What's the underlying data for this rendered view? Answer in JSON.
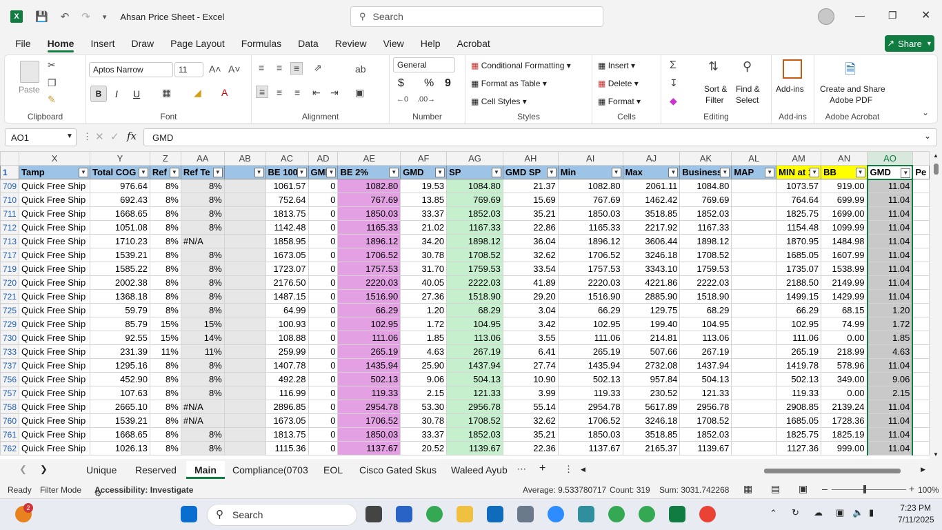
{
  "app": {
    "title": "Ahsan Price Sheet  -  Excel",
    "search_label": "Search"
  },
  "menu": [
    "File",
    "Home",
    "Insert",
    "Draw",
    "Page Layout",
    "Formulas",
    "Data",
    "Review",
    "View",
    "Help",
    "Acrobat"
  ],
  "share_label": "Share",
  "ribbon": {
    "clipboard": {
      "paste": "Paste",
      "group": "Clipboard"
    },
    "font": {
      "name": "Aptos Narrow",
      "size": "11",
      "group": "Font",
      "bold": "B",
      "italic": "I",
      "underline": "U"
    },
    "alignment": {
      "group": "Alignment"
    },
    "number": {
      "format": "General",
      "group": "Number",
      "currency": "$",
      "percent": "%",
      "comma": "9"
    },
    "styles": {
      "cond": "Conditional Formatting",
      "table": "Format as Table",
      "cell": "Cell Styles",
      "group": "Styles"
    },
    "cells": {
      "insert": "Insert",
      "delete": "Delete",
      "format": "Format",
      "group": "Cells"
    },
    "editing": {
      "sort1": "Sort &",
      "sort2": "Filter",
      "find1": "Find &",
      "find2": "Select",
      "group": "Editing"
    },
    "addins": {
      "label": "Add-ins",
      "group": "Add-ins"
    },
    "acrobat": {
      "label1": "Create and Share",
      "label2": "Adobe PDF",
      "group": "Adobe Acrobat"
    }
  },
  "formula": {
    "namebox": "AO1",
    "fx": "fx",
    "content": "GMD"
  },
  "columns": [
    "X",
    "Y",
    "Z",
    "AA",
    "AB",
    "AC",
    "AD",
    "AE",
    "AF",
    "AG",
    "AH",
    "AI",
    "AJ",
    "AK",
    "AL",
    "AM",
    "AN",
    "AO",
    ""
  ],
  "header_row": {
    "num": "1",
    "cells": [
      "Tamp",
      "Total COG",
      "Ref",
      "Ref Te",
      "",
      "BE 100",
      "GMI",
      "BE 2%",
      "GMD",
      "SP",
      "GMD SP",
      "Min",
      "Max",
      "Business",
      "MAP",
      "MIN at 1",
      "BB",
      "GMD",
      "Pe"
    ]
  },
  "rows": [
    {
      "num": "709",
      "cells": [
        "Quick Free Ship",
        "976.64",
        "8%",
        "8%",
        "",
        "1061.57",
        "0",
        "1082.80",
        "19.53",
        "1084.80",
        "21.37",
        "1082.80",
        "2061.11",
        "1084.80",
        "",
        "1073.57",
        "919.00",
        "11.04"
      ]
    },
    {
      "num": "710",
      "cells": [
        "Quick Free Ship",
        "692.43",
        "8%",
        "8%",
        "",
        "752.64",
        "0",
        "767.69",
        "13.85",
        "769.69",
        "15.69",
        "767.69",
        "1462.42",
        "769.69",
        "",
        "764.64",
        "699.99",
        "11.04"
      ]
    },
    {
      "num": "711",
      "cells": [
        "Quick Free Ship",
        "1668.65",
        "8%",
        "8%",
        "",
        "1813.75",
        "0",
        "1850.03",
        "33.37",
        "1852.03",
        "35.21",
        "1850.03",
        "3518.85",
        "1852.03",
        "",
        "1825.75",
        "1699.00",
        "11.04"
      ]
    },
    {
      "num": "712",
      "cells": [
        "Quick Free Ship",
        "1051.08",
        "8%",
        "8%",
        "",
        "1142.48",
        "0",
        "1165.33",
        "21.02",
        "1167.33",
        "22.86",
        "1165.33",
        "2217.92",
        "1167.33",
        "",
        "1154.48",
        "1099.99",
        "11.04"
      ]
    },
    {
      "num": "713",
      "cells": [
        "Quick Free Ship",
        "1710.23",
        "8%",
        "#N/A",
        "",
        "1858.95",
        "0",
        "1896.12",
        "34.20",
        "1898.12",
        "36.04",
        "1896.12",
        "3606.44",
        "1898.12",
        "",
        "1870.95",
        "1484.98",
        "11.04"
      ]
    },
    {
      "num": "717",
      "cells": [
        "Quick Free Ship",
        "1539.21",
        "8%",
        "8%",
        "",
        "1673.05",
        "0",
        "1706.52",
        "30.78",
        "1708.52",
        "32.62",
        "1706.52",
        "3246.18",
        "1708.52",
        "",
        "1685.05",
        "1607.99",
        "11.04"
      ]
    },
    {
      "num": "719",
      "cells": [
        "Quick Free Ship",
        "1585.22",
        "8%",
        "8%",
        "",
        "1723.07",
        "0",
        "1757.53",
        "31.70",
        "1759.53",
        "33.54",
        "1757.53",
        "3343.10",
        "1759.53",
        "",
        "1735.07",
        "1538.99",
        "11.04"
      ]
    },
    {
      "num": "720",
      "cells": [
        "Quick Free Ship",
        "2002.38",
        "8%",
        "8%",
        "",
        "2176.50",
        "0",
        "2220.03",
        "40.05",
        "2222.03",
        "41.89",
        "2220.03",
        "4221.86",
        "2222.03",
        "",
        "2188.50",
        "2149.99",
        "11.04"
      ]
    },
    {
      "num": "721",
      "cells": [
        "Quick Free Ship",
        "1368.18",
        "8%",
        "8%",
        "",
        "1487.15",
        "0",
        "1516.90",
        "27.36",
        "1518.90",
        "29.20",
        "1516.90",
        "2885.90",
        "1518.90",
        "",
        "1499.15",
        "1429.99",
        "11.04"
      ]
    },
    {
      "num": "725",
      "cells": [
        "Quick Free Ship",
        "59.79",
        "8%",
        "8%",
        "",
        "64.99",
        "0",
        "66.29",
        "1.20",
        "68.29",
        "3.04",
        "66.29",
        "129.75",
        "68.29",
        "",
        "66.29",
        "68.15",
        "1.20"
      ]
    },
    {
      "num": "729",
      "cells": [
        "Quick Free Ship",
        "85.79",
        "15%",
        "15%",
        "",
        "100.93",
        "0",
        "102.95",
        "1.72",
        "104.95",
        "3.42",
        "102.95",
        "199.40",
        "104.95",
        "",
        "102.95",
        "74.99",
        "1.72"
      ]
    },
    {
      "num": "730",
      "cells": [
        "Quick Free Ship",
        "92.55",
        "15%",
        "14%",
        "",
        "108.88",
        "0",
        "111.06",
        "1.85",
        "113.06",
        "3.55",
        "111.06",
        "214.81",
        "113.06",
        "",
        "111.06",
        "0.00",
        "1.85"
      ]
    },
    {
      "num": "733",
      "cells": [
        "Quick Free Ship",
        "231.39",
        "11%",
        "11%",
        "",
        "259.99",
        "0",
        "265.19",
        "4.63",
        "267.19",
        "6.41",
        "265.19",
        "507.66",
        "267.19",
        "",
        "265.19",
        "218.99",
        "4.63"
      ]
    },
    {
      "num": "737",
      "cells": [
        "Quick Free Ship",
        "1295.16",
        "8%",
        "8%",
        "",
        "1407.78",
        "0",
        "1435.94",
        "25.90",
        "1437.94",
        "27.74",
        "1435.94",
        "2732.08",
        "1437.94",
        "",
        "1419.78",
        "578.96",
        "11.04"
      ]
    },
    {
      "num": "756",
      "cells": [
        "Quick Free Ship",
        "452.90",
        "8%",
        "8%",
        "",
        "492.28",
        "0",
        "502.13",
        "9.06",
        "504.13",
        "10.90",
        "502.13",
        "957.84",
        "504.13",
        "",
        "502.13",
        "349.00",
        "9.06"
      ]
    },
    {
      "num": "757",
      "cells": [
        "Quick Free Ship",
        "107.63",
        "8%",
        "8%",
        "",
        "116.99",
        "0",
        "119.33",
        "2.15",
        "121.33",
        "3.99",
        "119.33",
        "230.52",
        "121.33",
        "",
        "119.33",
        "0.00",
        "2.15"
      ]
    },
    {
      "num": "758",
      "cells": [
        "Quick Free Ship",
        "2665.10",
        "8%",
        "#N/A",
        "",
        "2896.85",
        "0",
        "2954.78",
        "53.30",
        "2956.78",
        "55.14",
        "2954.78",
        "5617.89",
        "2956.78",
        "",
        "2908.85",
        "2139.24",
        "11.04"
      ]
    },
    {
      "num": "760",
      "cells": [
        "Quick Free Ship",
        "1539.21",
        "8%",
        "#N/A",
        "",
        "1673.05",
        "0",
        "1706.52",
        "30.78",
        "1708.52",
        "32.62",
        "1706.52",
        "3246.18",
        "1708.52",
        "",
        "1685.05",
        "1728.36",
        "11.04"
      ]
    },
    {
      "num": "761",
      "cells": [
        "Quick Free Ship",
        "1668.65",
        "8%",
        "8%",
        "",
        "1813.75",
        "0",
        "1850.03",
        "33.37",
        "1852.03",
        "35.21",
        "1850.03",
        "3518.85",
        "1852.03",
        "",
        "1825.75",
        "1825.19",
        "11.04"
      ]
    },
    {
      "num": "762",
      "cells": [
        "Quick Free Ship",
        "1026.13",
        "8%",
        "8%",
        "",
        "1115.36",
        "0",
        "1137.67",
        "20.52",
        "1139.67",
        "22.36",
        "1137.67",
        "2165.37",
        "1139.67",
        "",
        "1127.36",
        "999.00",
        "11.04"
      ]
    }
  ],
  "sheets": [
    "Unique",
    "Reserved",
    "Main",
    "Compliance(0703",
    "EOL",
    "Cisco Gated Skus",
    "Waleed Ayub"
  ],
  "status": {
    "ready": "Ready",
    "filter": "Filter Mode",
    "access": "Accessibility: Investigate",
    "average": "Average: 9.533780717",
    "count": "Count: 319",
    "sum": "Sum: 3031.742268",
    "zoom": "100%"
  },
  "taskbar": {
    "search": "Search",
    "time": "7:23 PM",
    "date": "7/11/2025",
    "badge": "2"
  },
  "colors": {
    "excel_green": "#107c41",
    "header_blue": "#9dc3e6",
    "header_yellow": "#ffff00",
    "be2_pink": "#e3a1e3",
    "sp_green": "#c6efce",
    "ab_gray": "#e7e7e7",
    "ao_gray": "#c9c9c9"
  }
}
